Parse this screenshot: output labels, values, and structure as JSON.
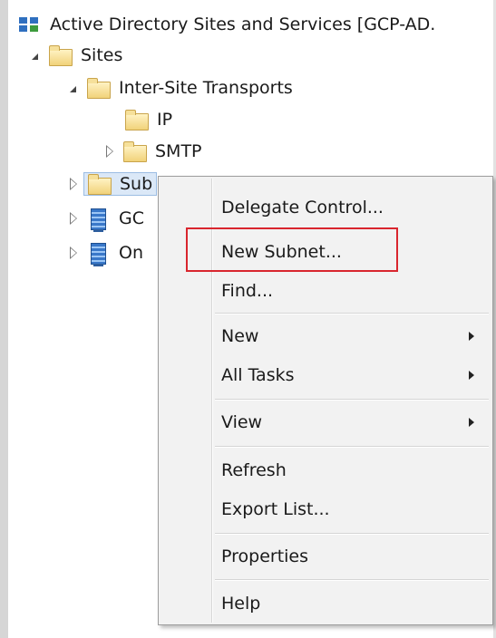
{
  "window": {
    "root_title": "Active Directory Sites and Services [GCP-AD."
  },
  "tree": {
    "sites": "Sites",
    "inter_site_transports": "Inter-Site Transports",
    "ip": "IP",
    "smtp": "SMTP",
    "subnets_partial": "Sub",
    "gc_partial": "GC",
    "on_partial": "On"
  },
  "context_menu": {
    "items": [
      {
        "label": "Delegate Control...",
        "has_submenu": false
      },
      {
        "label": "New Subnet...",
        "has_submenu": false,
        "highlighted": true
      },
      {
        "label": "Find...",
        "has_submenu": false
      },
      {
        "label": "New",
        "has_submenu": true
      },
      {
        "label": "All Tasks",
        "has_submenu": true
      },
      {
        "label": "View",
        "has_submenu": true
      },
      {
        "label": "Refresh",
        "has_submenu": false
      },
      {
        "label": "Export List...",
        "has_submenu": false
      },
      {
        "label": "Properties",
        "has_submenu": false
      },
      {
        "label": "Help",
        "has_submenu": false
      }
    ]
  },
  "colors": {
    "highlight_box": "#d9262e",
    "selection_fill": "#dbe8f7",
    "menu_background": "#f2f2f2"
  },
  "icons": {
    "root": "ad-sites-icon",
    "folder": "folder-icon",
    "server": "site-server-icon"
  }
}
